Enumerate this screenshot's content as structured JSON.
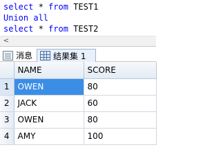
{
  "editor": {
    "lines": [
      {
        "keyword1": "select",
        "mid": " * ",
        "keyword2": "from",
        "rest": " TEST1"
      },
      {
        "keyword1": "Union all",
        "mid": "",
        "keyword2": "",
        "rest": ""
      },
      {
        "keyword1": "select",
        "mid": " * ",
        "keyword2": "from",
        "rest": " TEST2"
      }
    ],
    "scroll_left_glyph": "<"
  },
  "tabs": {
    "messages": "消息",
    "results": "结果集 1"
  },
  "grid": {
    "columns": [
      "NAME",
      "SCORE"
    ],
    "rows": [
      {
        "num": "1",
        "name": "OWEN",
        "score": "80"
      },
      {
        "num": "2",
        "name": "JACK",
        "score": "60"
      },
      {
        "num": "3",
        "name": "OWEN",
        "score": "80"
      },
      {
        "num": "4",
        "name": "AMY",
        "score": "100"
      }
    ],
    "selected_color": "#3b8ee6"
  }
}
